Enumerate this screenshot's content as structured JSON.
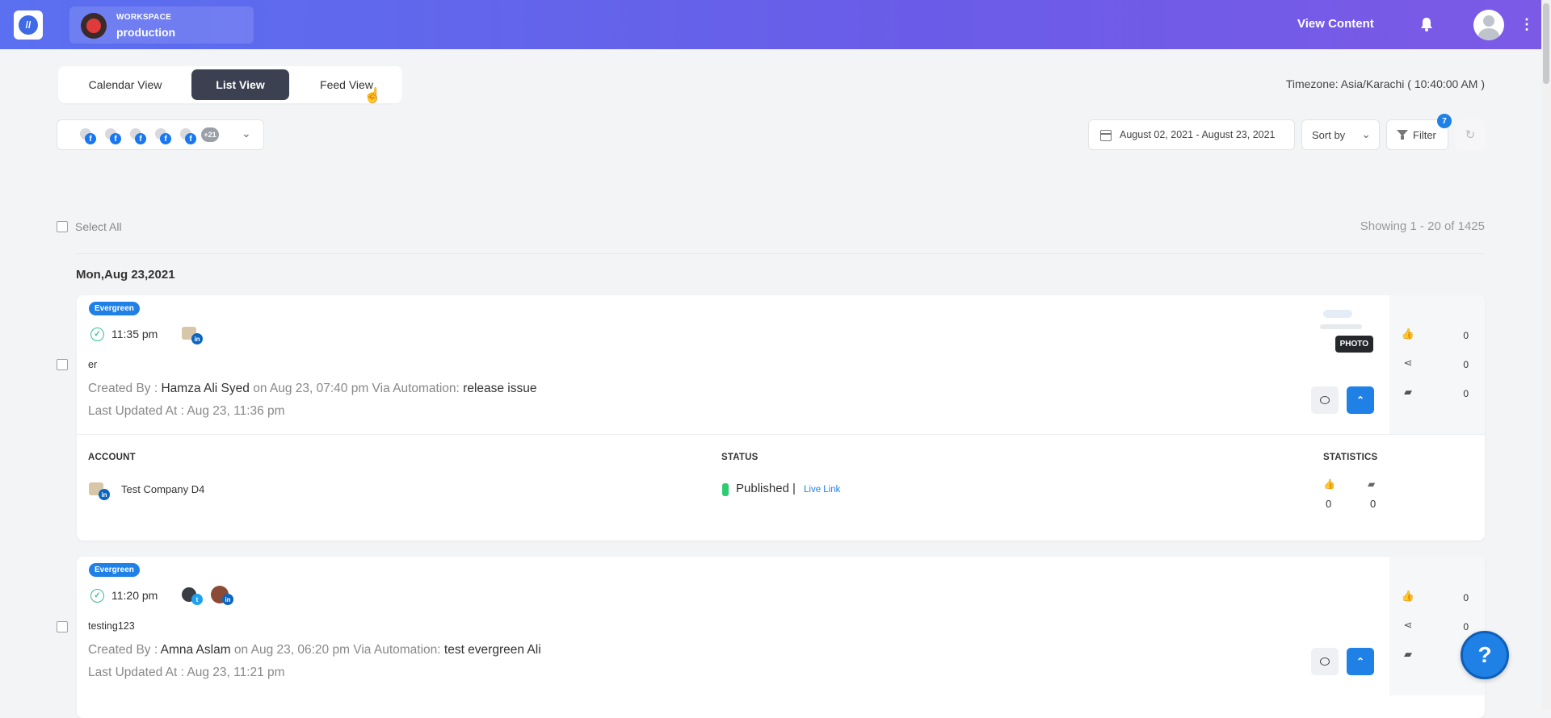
{
  "header": {
    "workspace_label": "WORKSPACE",
    "workspace_name": "production",
    "view_content": "View Content"
  },
  "tabs": [
    {
      "label": "Calendar View",
      "active": false
    },
    {
      "label": "List View",
      "active": true
    },
    {
      "label": "Feed View",
      "active": false
    }
  ],
  "timezone": "Timezone: Asia/Karachi ( 10:40:00 AM )",
  "accounts_select": {
    "extra_count": "+21"
  },
  "date_range": "August 02, 2021 - August 23, 2021",
  "sort_label": "Sort by",
  "filter": {
    "label": "Filter",
    "badge": "7"
  },
  "select_all": "Select All",
  "showing": "Showing 1 - 20 of 1425",
  "group_date": "Mon,Aug 23,2021",
  "posts": [
    {
      "tag": "Evergreen",
      "time": "11:35 pm",
      "text": "er",
      "created_prefix": "Created By : ",
      "author": "Hamza Ali Syed",
      "created_mid": " on Aug 23, 07:40 pm Via Automation: ",
      "automation": "release issue",
      "updated": "Last Updated At : Aug 23, 11:36 pm",
      "media_tag": "PHOTO",
      "stats": [
        "0",
        "0",
        "0"
      ],
      "table": {
        "col_account": "ACCOUNT",
        "col_status": "STATUS",
        "col_statistics": "STATISTICS",
        "account_name": "Test Company D4",
        "status": "Published |",
        "live_link": "Live Link",
        "stat_values": [
          "0",
          "0"
        ]
      }
    },
    {
      "tag": "Evergreen",
      "time": "11:20 pm",
      "text": "testing123",
      "created_prefix": "Created By : ",
      "author": "Amna Aslam",
      "created_mid": " on Aug 23, 06:20 pm Via Automation: ",
      "automation": "test evergreen Ali",
      "updated": "Last Updated At : Aug 23, 11:21 pm",
      "stats": [
        "0",
        "0"
      ]
    }
  ],
  "help_label": "?"
}
